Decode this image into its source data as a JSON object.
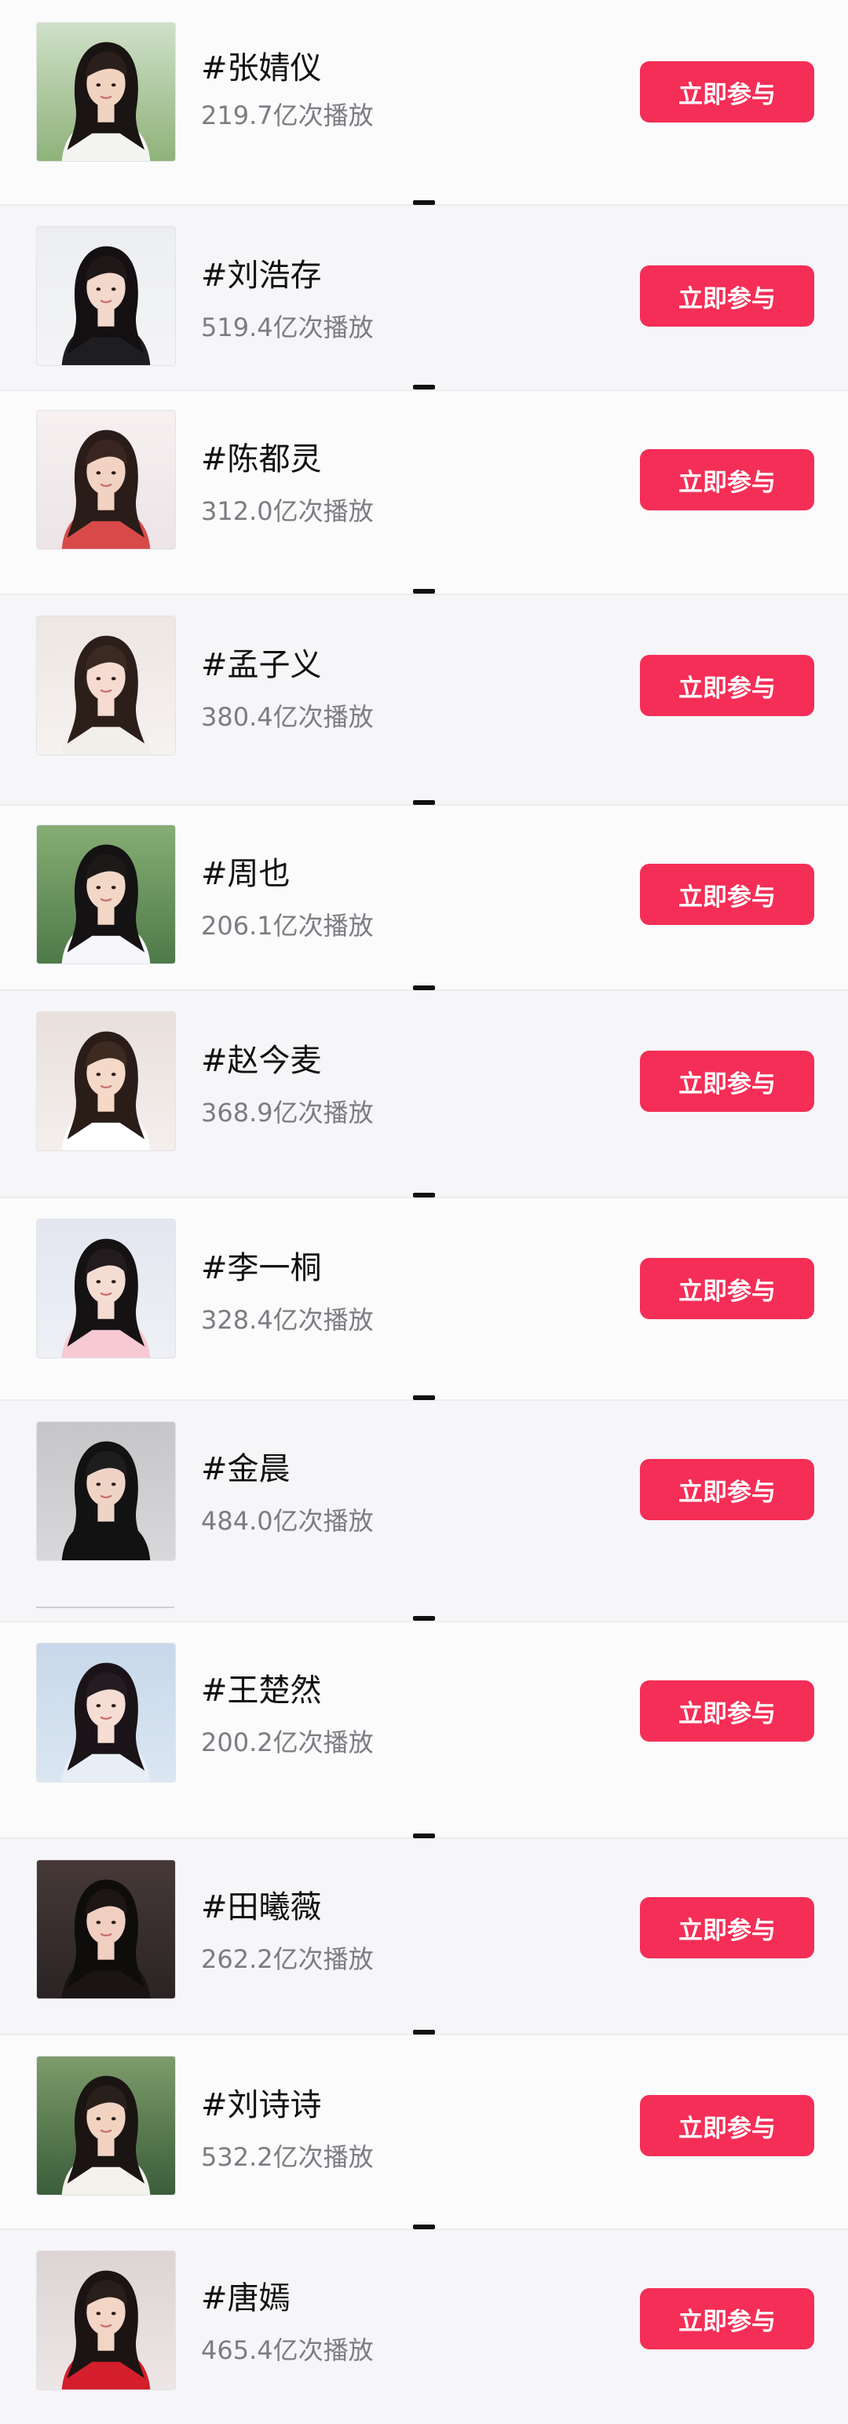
{
  "colors": {
    "accent": "#f52e57",
    "title": "#111111",
    "subtitle": "#7c7c82"
  },
  "list": {
    "items": [
      {
        "title": "#张婧仪",
        "plays": "219.7亿次播放",
        "button": "立即参与",
        "avatar": "portrait-park"
      },
      {
        "title": "#刘浩存",
        "plays": "519.4亿次播放",
        "button": "立即参与",
        "avatar": "portrait-studio"
      },
      {
        "title": "#陈都灵",
        "plays": "312.0亿次播放",
        "button": "立即参与",
        "avatar": "portrait-hand"
      },
      {
        "title": "#孟子义",
        "plays": "380.4亿次播放",
        "button": "立即参与",
        "avatar": "portrait-chin"
      },
      {
        "title": "#周也",
        "plays": "206.1亿次播放",
        "button": "立即参与",
        "avatar": "portrait-green"
      },
      {
        "title": "#赵今麦",
        "plays": "368.9亿次播放",
        "button": "立即参与",
        "avatar": "portrait-flower"
      },
      {
        "title": "#李一桐",
        "plays": "328.4亿次播放",
        "button": "立即参与",
        "avatar": "portrait-pink"
      },
      {
        "title": "#金晨",
        "plays": "484.0亿次播放",
        "button": "立即参与",
        "avatar": "portrait-pose"
      },
      {
        "title": "#王楚然",
        "plays": "200.2亿次播放",
        "button": "立即参与",
        "avatar": "portrait-blue"
      },
      {
        "title": "#田曦薇",
        "plays": "262.2亿次播放",
        "button": "立即参与",
        "avatar": "portrait-dark"
      },
      {
        "title": "#刘诗诗",
        "plays": "532.2亿次播放",
        "button": "立即参与",
        "avatar": "portrait-outdoor"
      },
      {
        "title": "#唐嫣",
        "plays": "465.4亿次播放",
        "button": "立即参与",
        "avatar": "portrait-red"
      }
    ]
  }
}
